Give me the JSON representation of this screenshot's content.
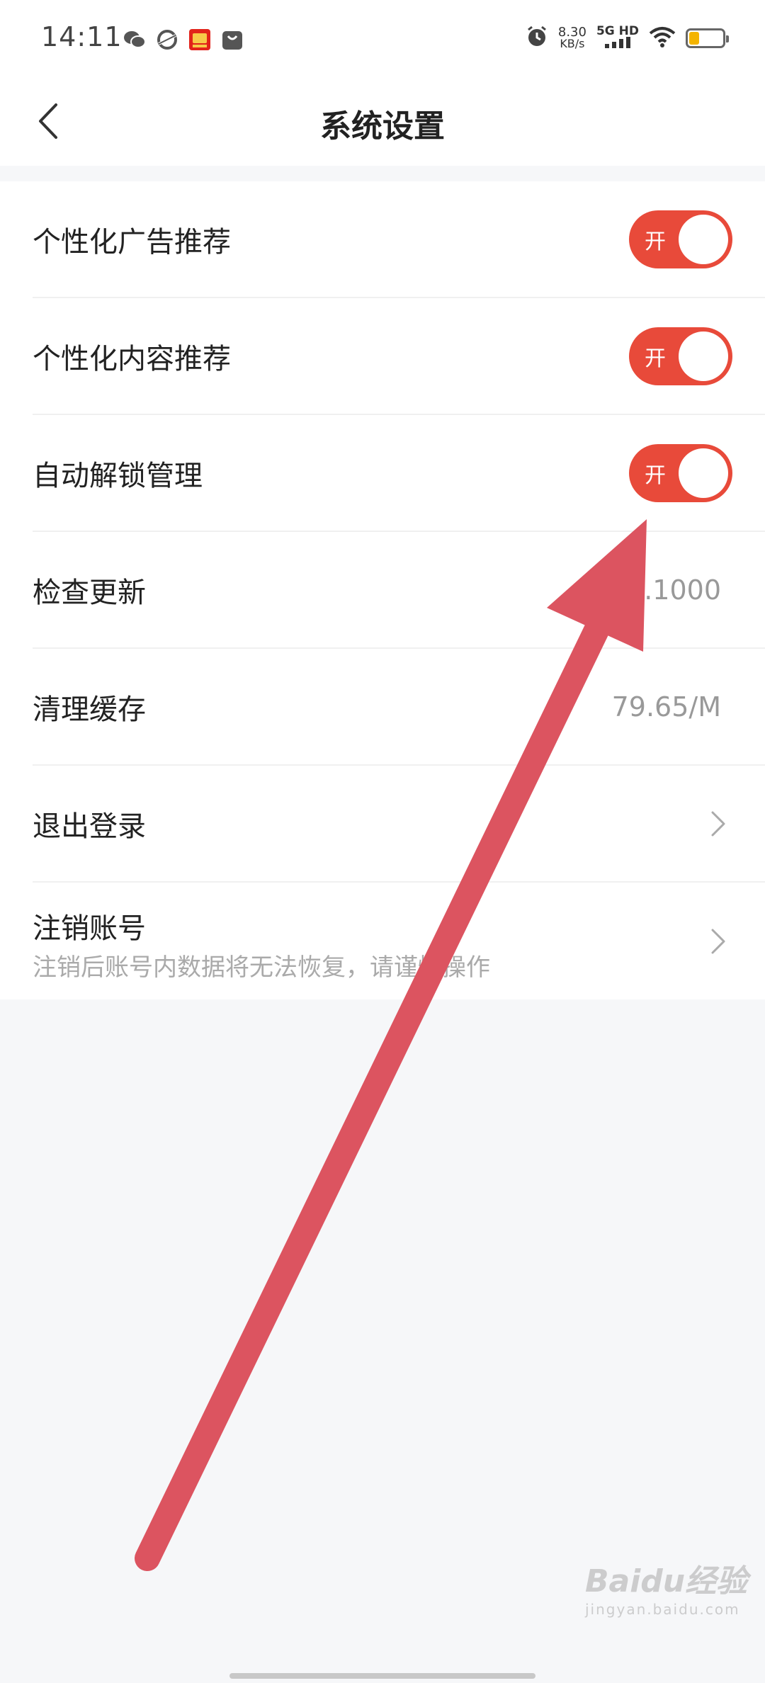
{
  "status_bar": {
    "time": "14:11",
    "notification_icons": [
      "wechat-icon",
      "browser-icon",
      "taobao-icon",
      "shopping-bag-icon"
    ],
    "net_speed_value": "8.30",
    "net_speed_unit": "KB/s",
    "network_type": "5G HD",
    "battery_level": 0.3,
    "battery_color": "#f4b400"
  },
  "nav": {
    "title": "系统设置"
  },
  "settings": {
    "ad_recommend": {
      "label": "个性化广告推荐",
      "toggle_text": "开"
    },
    "content_recommend": {
      "label": "个性化内容推荐",
      "toggle_text": "开"
    },
    "auto_unlock": {
      "label": "自动解锁管理",
      "toggle_text": "开"
    },
    "check_update": {
      "label": "检查更新",
      "value": "1.1000"
    },
    "clear_cache": {
      "label": "清理缓存",
      "value": "79.65/M"
    },
    "logout": {
      "label": "退出登录"
    },
    "delete_account": {
      "label": "注销账号",
      "subtitle": "注销后账号内数据将无法恢复，请谨慎操作"
    }
  },
  "watermark": {
    "main": "Baidu经验",
    "sub": "jingyan.baidu.com"
  },
  "colors": {
    "accent": "#e84a3a",
    "annotation_arrow": "#dc5460",
    "background": "#f6f7f9"
  }
}
